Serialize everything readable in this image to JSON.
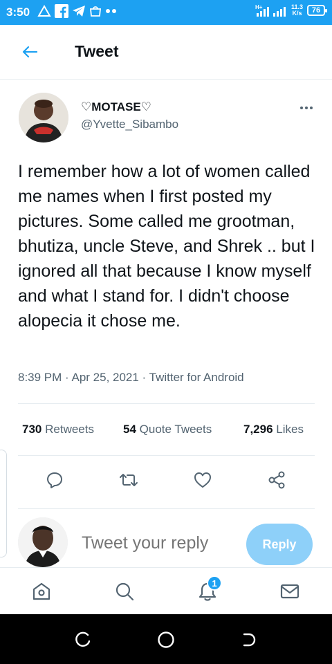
{
  "status_bar": {
    "time": "3:50",
    "speed_value": "11.3",
    "speed_unit": "K/s",
    "battery": "76",
    "network": "H+"
  },
  "header": {
    "title": "Tweet"
  },
  "tweet": {
    "display_name": "♡MOTASE♡",
    "handle": "@Yvette_Sibambo",
    "text": "I remember how a lot of women called me names when I first posted my pictures. Some called me grootman, bhutiza, uncle Steve, and Shrek .. but I ignored all that because I know myself and what I stand for. I didn't choose alopecia it chose me.",
    "meta": "8:39 PM · Apr 25, 2021 · Twitter for Android"
  },
  "stats": {
    "retweets_count": "730",
    "retweets_label": "Retweets",
    "quotes_count": "54",
    "quotes_label": "Quote Tweets",
    "likes_count": "7,296",
    "likes_label": "Likes"
  },
  "reply": {
    "placeholder": "Tweet your reply",
    "button_label": "Reply"
  },
  "bottom_nav": {
    "notifications_badge": "1",
    "items": [
      "home-icon",
      "search-icon",
      "notifications-icon",
      "messages-icon"
    ]
  },
  "colors": {
    "brand": "#1da1f2",
    "reply_button": "#8ed0f9",
    "text_secondary": "#536471"
  }
}
